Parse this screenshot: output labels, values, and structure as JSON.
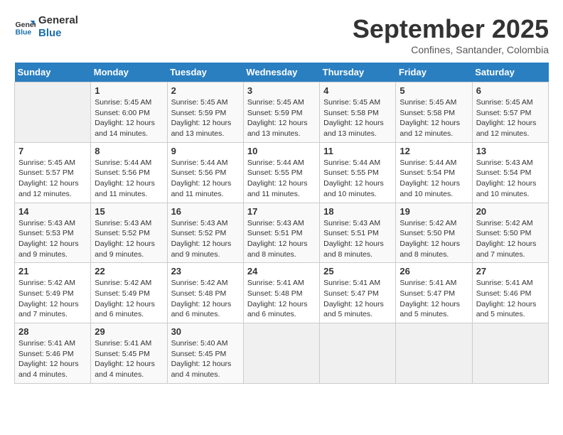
{
  "logo": {
    "line1": "General",
    "line2": "Blue"
  },
  "title": "September 2025",
  "location": "Confines, Santander, Colombia",
  "weekdays": [
    "Sunday",
    "Monday",
    "Tuesday",
    "Wednesday",
    "Thursday",
    "Friday",
    "Saturday"
  ],
  "weeks": [
    [
      {
        "day": "",
        "info": ""
      },
      {
        "day": "1",
        "info": "Sunrise: 5:45 AM\nSunset: 6:00 PM\nDaylight: 12 hours\nand 14 minutes."
      },
      {
        "day": "2",
        "info": "Sunrise: 5:45 AM\nSunset: 5:59 PM\nDaylight: 12 hours\nand 13 minutes."
      },
      {
        "day": "3",
        "info": "Sunrise: 5:45 AM\nSunset: 5:59 PM\nDaylight: 12 hours\nand 13 minutes."
      },
      {
        "day": "4",
        "info": "Sunrise: 5:45 AM\nSunset: 5:58 PM\nDaylight: 12 hours\nand 13 minutes."
      },
      {
        "day": "5",
        "info": "Sunrise: 5:45 AM\nSunset: 5:58 PM\nDaylight: 12 hours\nand 12 minutes."
      },
      {
        "day": "6",
        "info": "Sunrise: 5:45 AM\nSunset: 5:57 PM\nDaylight: 12 hours\nand 12 minutes."
      }
    ],
    [
      {
        "day": "7",
        "info": "Sunrise: 5:45 AM\nSunset: 5:57 PM\nDaylight: 12 hours\nand 12 minutes."
      },
      {
        "day": "8",
        "info": "Sunrise: 5:44 AM\nSunset: 5:56 PM\nDaylight: 12 hours\nand 11 minutes."
      },
      {
        "day": "9",
        "info": "Sunrise: 5:44 AM\nSunset: 5:56 PM\nDaylight: 12 hours\nand 11 minutes."
      },
      {
        "day": "10",
        "info": "Sunrise: 5:44 AM\nSunset: 5:55 PM\nDaylight: 12 hours\nand 11 minutes."
      },
      {
        "day": "11",
        "info": "Sunrise: 5:44 AM\nSunset: 5:55 PM\nDaylight: 12 hours\nand 10 minutes."
      },
      {
        "day": "12",
        "info": "Sunrise: 5:44 AM\nSunset: 5:54 PM\nDaylight: 12 hours\nand 10 minutes."
      },
      {
        "day": "13",
        "info": "Sunrise: 5:43 AM\nSunset: 5:54 PM\nDaylight: 12 hours\nand 10 minutes."
      }
    ],
    [
      {
        "day": "14",
        "info": "Sunrise: 5:43 AM\nSunset: 5:53 PM\nDaylight: 12 hours\nand 9 minutes."
      },
      {
        "day": "15",
        "info": "Sunrise: 5:43 AM\nSunset: 5:52 PM\nDaylight: 12 hours\nand 9 minutes."
      },
      {
        "day": "16",
        "info": "Sunrise: 5:43 AM\nSunset: 5:52 PM\nDaylight: 12 hours\nand 9 minutes."
      },
      {
        "day": "17",
        "info": "Sunrise: 5:43 AM\nSunset: 5:51 PM\nDaylight: 12 hours\nand 8 minutes."
      },
      {
        "day": "18",
        "info": "Sunrise: 5:43 AM\nSunset: 5:51 PM\nDaylight: 12 hours\nand 8 minutes."
      },
      {
        "day": "19",
        "info": "Sunrise: 5:42 AM\nSunset: 5:50 PM\nDaylight: 12 hours\nand 8 minutes."
      },
      {
        "day": "20",
        "info": "Sunrise: 5:42 AM\nSunset: 5:50 PM\nDaylight: 12 hours\nand 7 minutes."
      }
    ],
    [
      {
        "day": "21",
        "info": "Sunrise: 5:42 AM\nSunset: 5:49 PM\nDaylight: 12 hours\nand 7 minutes."
      },
      {
        "day": "22",
        "info": "Sunrise: 5:42 AM\nSunset: 5:49 PM\nDaylight: 12 hours\nand 6 minutes."
      },
      {
        "day": "23",
        "info": "Sunrise: 5:42 AM\nSunset: 5:48 PM\nDaylight: 12 hours\nand 6 minutes."
      },
      {
        "day": "24",
        "info": "Sunrise: 5:41 AM\nSunset: 5:48 PM\nDaylight: 12 hours\nand 6 minutes."
      },
      {
        "day": "25",
        "info": "Sunrise: 5:41 AM\nSunset: 5:47 PM\nDaylight: 12 hours\nand 5 minutes."
      },
      {
        "day": "26",
        "info": "Sunrise: 5:41 AM\nSunset: 5:47 PM\nDaylight: 12 hours\nand 5 minutes."
      },
      {
        "day": "27",
        "info": "Sunrise: 5:41 AM\nSunset: 5:46 PM\nDaylight: 12 hours\nand 5 minutes."
      }
    ],
    [
      {
        "day": "28",
        "info": "Sunrise: 5:41 AM\nSunset: 5:46 PM\nDaylight: 12 hours\nand 4 minutes."
      },
      {
        "day": "29",
        "info": "Sunrise: 5:41 AM\nSunset: 5:45 PM\nDaylight: 12 hours\nand 4 minutes."
      },
      {
        "day": "30",
        "info": "Sunrise: 5:40 AM\nSunset: 5:45 PM\nDaylight: 12 hours\nand 4 minutes."
      },
      {
        "day": "",
        "info": ""
      },
      {
        "day": "",
        "info": ""
      },
      {
        "day": "",
        "info": ""
      },
      {
        "day": "",
        "info": ""
      }
    ]
  ]
}
